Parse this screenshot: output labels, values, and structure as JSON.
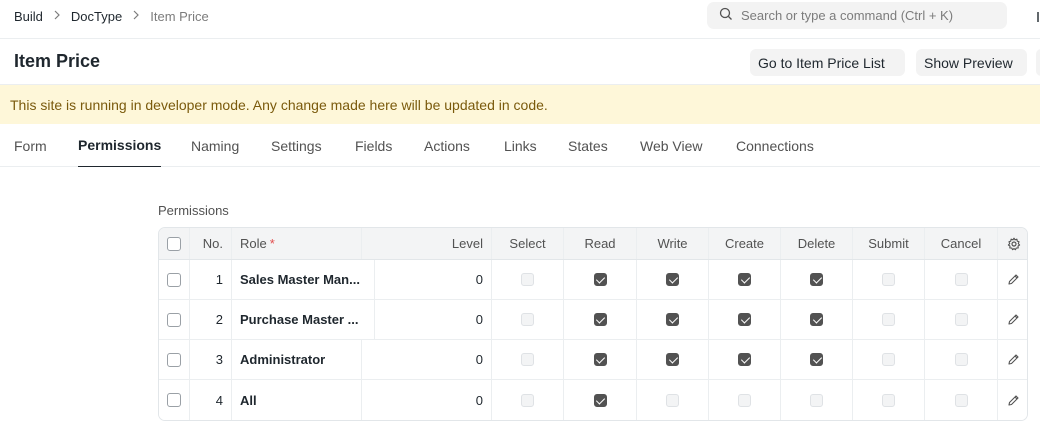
{
  "breadcrumb": [
    "Build",
    "DocType",
    "Item Price"
  ],
  "search": {
    "placeholder": "Search or type a command (Ctrl + K)"
  },
  "page": {
    "title": "Item Price",
    "go_to_list_label": "Go to Item Price List",
    "show_preview_label": "Show Preview"
  },
  "alert": {
    "text": "This site is running in developer mode. Any change made here will be updated in code."
  },
  "tabs": [
    {
      "label": "Form",
      "active": false
    },
    {
      "label": "Permissions",
      "active": true
    },
    {
      "label": "Naming",
      "active": false
    },
    {
      "label": "Settings",
      "active": false
    },
    {
      "label": "Fields",
      "active": false
    },
    {
      "label": "Actions",
      "active": false
    },
    {
      "label": "Links",
      "active": false
    },
    {
      "label": "States",
      "active": false
    },
    {
      "label": "Web View",
      "active": false
    },
    {
      "label": "Connections",
      "active": false
    }
  ],
  "permissions": {
    "section_label": "Permissions",
    "columns": {
      "no": "No.",
      "role": "Role",
      "role_required_mark": "*",
      "level": "Level",
      "select": "Select",
      "read": "Read",
      "write": "Write",
      "create": "Create",
      "delete": "Delete",
      "submit": "Submit",
      "cancel": "Cancel"
    },
    "rows": [
      {
        "no": "1",
        "role": "Sales Master Man...",
        "level": "0",
        "select": false,
        "read": true,
        "write": true,
        "create": true,
        "delete": true,
        "submit": false,
        "cancel": false
      },
      {
        "no": "2",
        "role": "Purchase Master ...",
        "level": "0",
        "select": false,
        "read": true,
        "write": true,
        "create": true,
        "delete": true,
        "submit": false,
        "cancel": false
      },
      {
        "no": "3",
        "role": "Administrator",
        "level": "0",
        "select": false,
        "read": true,
        "write": true,
        "create": true,
        "delete": true,
        "submit": false,
        "cancel": false
      },
      {
        "no": "4",
        "role": "All",
        "level": "0",
        "select": false,
        "read": true,
        "write": false,
        "create": false,
        "delete": false,
        "submit": false,
        "cancel": false
      }
    ]
  }
}
